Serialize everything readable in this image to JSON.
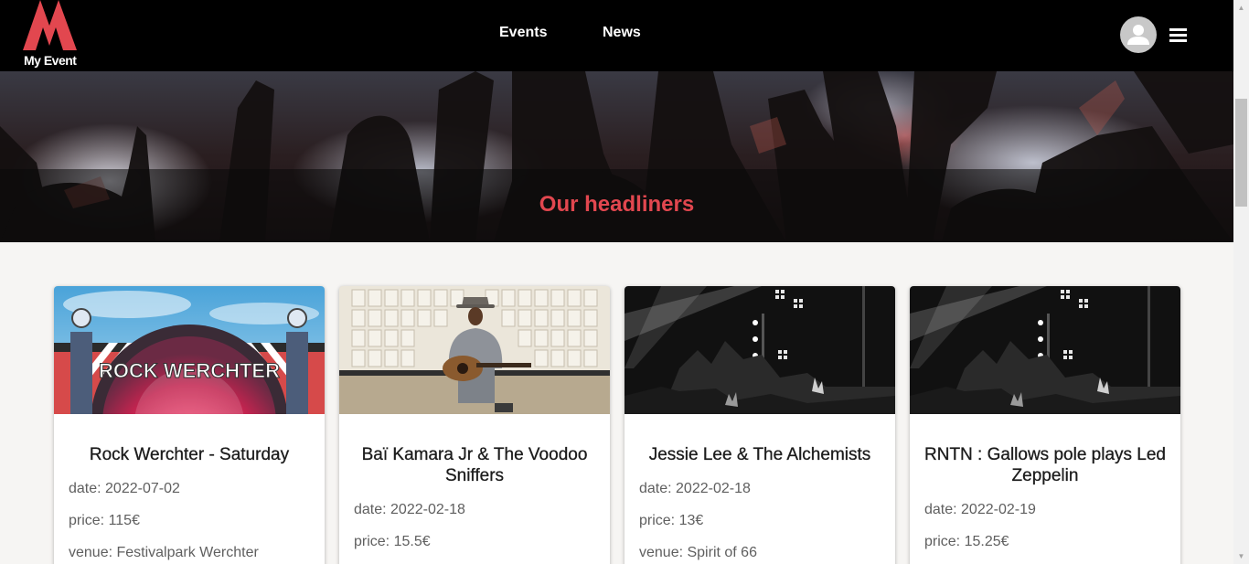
{
  "app": {
    "logo_text": "My Event",
    "brand_color": "#e2474f"
  },
  "nav": {
    "items": [
      {
        "label": "Events"
      },
      {
        "label": "News"
      }
    ]
  },
  "hero": {
    "title": "Our headliners"
  },
  "events": [
    {
      "title": "Rock Werchter - Saturday",
      "date": "date: 2022-07-02",
      "price": "price: 115€",
      "venue": "venue: Festivalpark Werchter",
      "image": "rock-werchter-festival-image",
      "image_text": "ROCK WERCHTER"
    },
    {
      "title": "Baï Kamara Jr & The Voodoo Sniffers",
      "date": "date: 2022-02-18",
      "price": "price: 15.5€",
      "venue": "",
      "image": "guitarist-portrait-image"
    },
    {
      "title": "Jessie Lee & The Alchemists",
      "date": "date: 2022-02-18",
      "price": "price: 13€",
      "venue": "venue: Spirit of 66",
      "image": "concert-stage-lights-image"
    },
    {
      "title": "RNTN : Gallows pole plays Led Zeppelin",
      "date": "date: 2022-02-19",
      "price": "price: 15.25€",
      "venue": "",
      "image": "concert-stage-lights-image"
    }
  ],
  "icons": {
    "avatar": "user-avatar-icon",
    "menu": "hamburger-menu-icon"
  }
}
